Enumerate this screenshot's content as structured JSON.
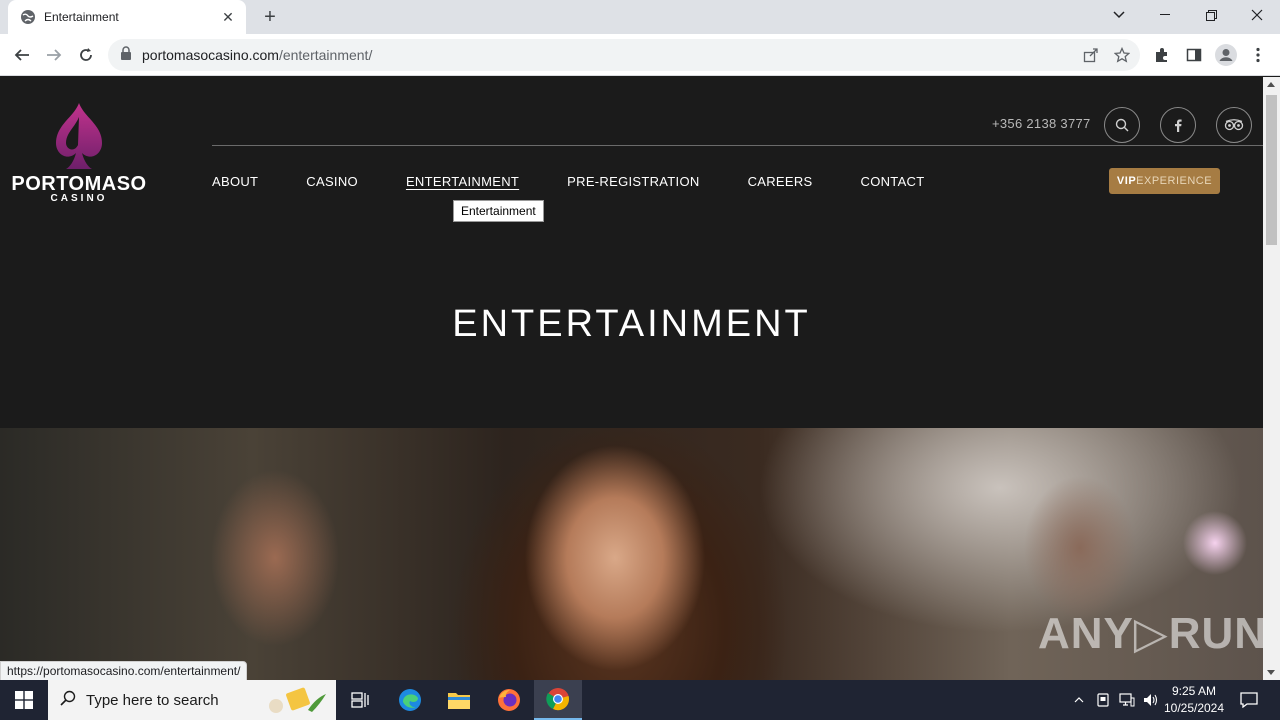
{
  "browser": {
    "tab_title": "Entertainment",
    "url_domain": "portomasocasino.com",
    "url_path": "/entertainment/",
    "status_url": "https://portomasocasino.com/entertainment/"
  },
  "site": {
    "brand": "PORTOMASO",
    "brand_sub": "CASINO",
    "phone": "+356 2138 3777",
    "nav": [
      "ABOUT",
      "CASINO",
      "ENTERTAINMENT",
      "PRE-REGISTRATION",
      "CAREERS",
      "CONTACT"
    ],
    "active_nav": "ENTERTAINMENT",
    "tooltip": "Entertainment",
    "vip_bold": "VIP",
    "vip_rest": "EXPERIENCE",
    "page_title": "ENTERTAINMENT",
    "accent_color": "#a67c43",
    "logo_color": "#b0287a"
  },
  "watermark": "ANY▷RUN",
  "taskbar": {
    "search_placeholder": "Type here to search",
    "time": "9:25 AM",
    "date": "10/25/2024"
  }
}
